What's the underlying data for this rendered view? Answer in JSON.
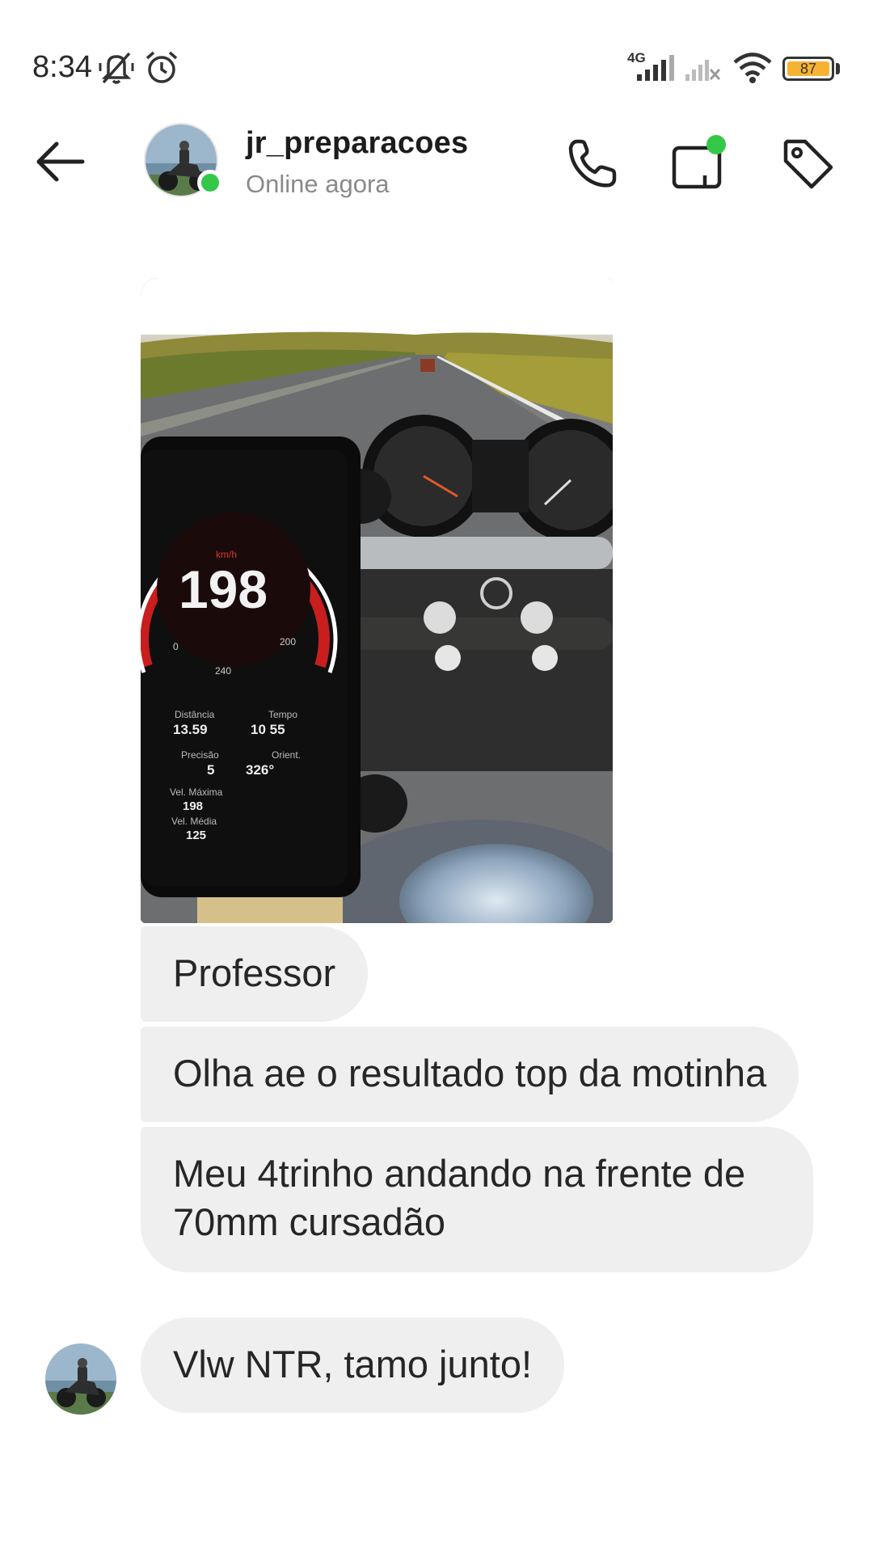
{
  "status_bar": {
    "time": "8:34",
    "network": "4G",
    "battery": "87",
    "icons": [
      "mute-icon",
      "alarm-icon",
      "signal-4g-icon",
      "signal-no-service-icon",
      "wifi-icon",
      "battery-icon"
    ]
  },
  "header": {
    "username": "jr_preparacoes",
    "status": "Online agora",
    "online_color": "#35c748",
    "icons": [
      "back-arrow-icon",
      "phone-call-icon",
      "video-call-icon",
      "tag-icon"
    ]
  },
  "messages": [
    {
      "type": "image",
      "description_icon": "motorcycle-speedometer-photo"
    },
    {
      "type": "text",
      "text": "Professor"
    },
    {
      "type": "text",
      "text": "Olha ae o resultado top da motinha"
    },
    {
      "type": "text",
      "text": "Meu 4trinho andando na frente de 70mm cursadão"
    },
    {
      "type": "text",
      "text": "Vlw NTR, tamo junto!"
    }
  ],
  "photo": {
    "speed": "198",
    "unit": "km/h",
    "dial_min": "0",
    "dial_mid": "200",
    "dial_max": "240",
    "stats": [
      {
        "label": "Distância",
        "value": "13.59"
      },
      {
        "label": "Tempo",
        "value": "10 55"
      },
      {
        "label": "Precisão",
        "value": "5"
      },
      {
        "label": "Orient.",
        "value": "326°"
      },
      {
        "label": "Vel. Máxima",
        "value": "198"
      },
      {
        "label": "Vel. Média",
        "value": "125"
      }
    ]
  },
  "colors": {
    "bubble_bg": "#efefef",
    "text": "#262626",
    "muted": "#8a8a8a"
  }
}
